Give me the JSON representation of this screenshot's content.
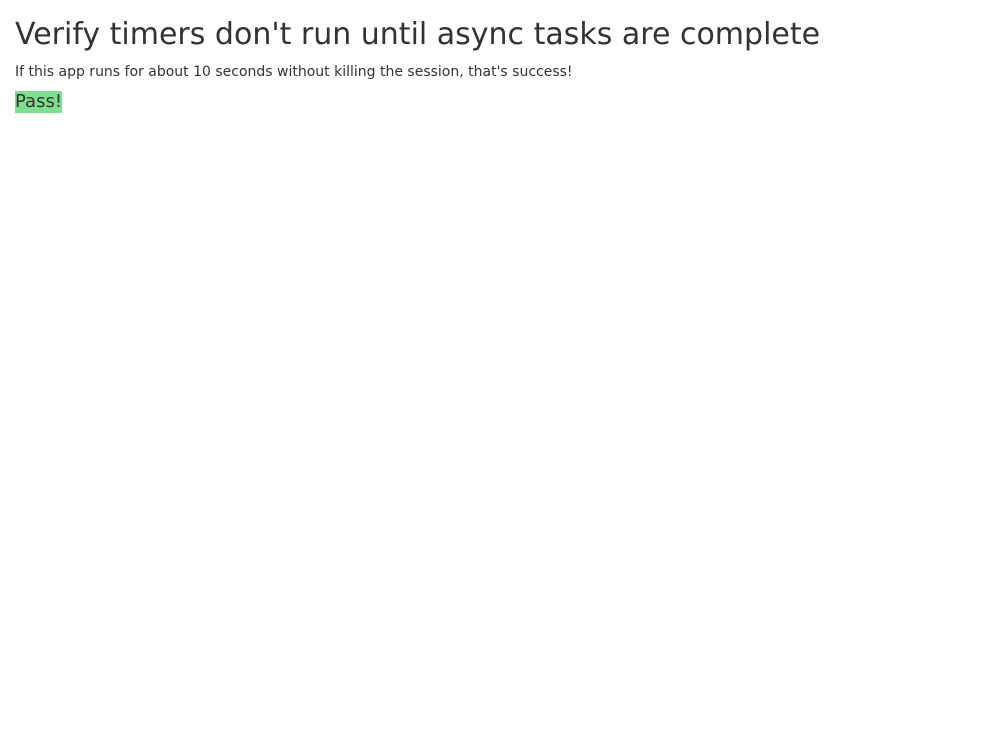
{
  "page": {
    "title": "Verify timers don't run until async tasks are complete",
    "description": "If this app runs for about 10 seconds without killing the session, that's success!",
    "status": "Pass!"
  },
  "colors": {
    "text": "#333333",
    "background": "#ffffff",
    "status_success": "#7ee08f"
  }
}
